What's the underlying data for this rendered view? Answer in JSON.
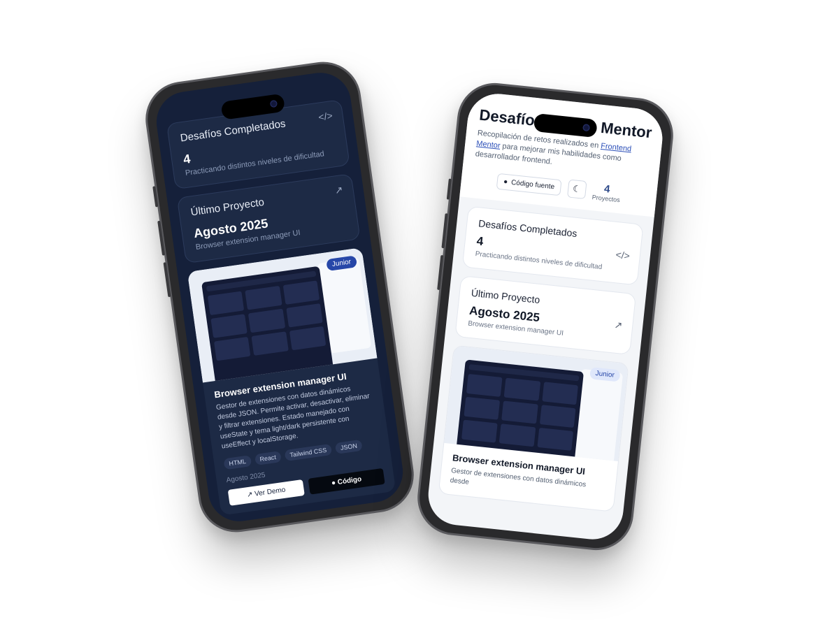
{
  "left_phone": {
    "completed_card": {
      "title": "Desafíos Completados",
      "count": "4",
      "subtitle": "Practicando distintos niveles de dificultad",
      "icon": "code-icon"
    },
    "latest_card": {
      "title": "Último Proyecto",
      "date": "Agosto 2025",
      "subtitle": "Browser extension manager UI",
      "icon": "external-link-icon"
    },
    "project": {
      "badge": "Junior",
      "title": "Browser extension manager UI",
      "description": "Gestor de extensiones con datos dinámicos desde JSON. Permite activar, desactivar, eliminar y filtrar extensiones. Estado manejado con useState y tema light/dark persistente con useEffect y localStorage.",
      "tags": [
        "HTML",
        "React",
        "Tailwind CSS",
        "JSON"
      ],
      "date": "Agosto 2025",
      "demo_label": "Ver Demo",
      "code_label": "Código"
    }
  },
  "right_phone": {
    "title": "Desafíos",
    "title_end": "Mentor",
    "description_prefix": "Recopilación de retos realizados en ",
    "description_link": "Frontend Mentor",
    "description_suffix": " para mejorar mis habilidades como desarrollador frontend.",
    "source_button": "Código fuente",
    "projects_count": "4",
    "projects_label": "Proyectos",
    "completed_card": {
      "title": "Desafíos Completados",
      "count": "4",
      "subtitle": "Practicando distintos niveles de dificultad"
    },
    "latest_card": {
      "title": "Último Proyecto",
      "date": "Agosto 2025",
      "subtitle": "Browser extension manager UI"
    },
    "project": {
      "badge": "Junior",
      "title": "Browser extension manager UI",
      "description": "Gestor de extensiones con datos dinámicos desde"
    }
  }
}
